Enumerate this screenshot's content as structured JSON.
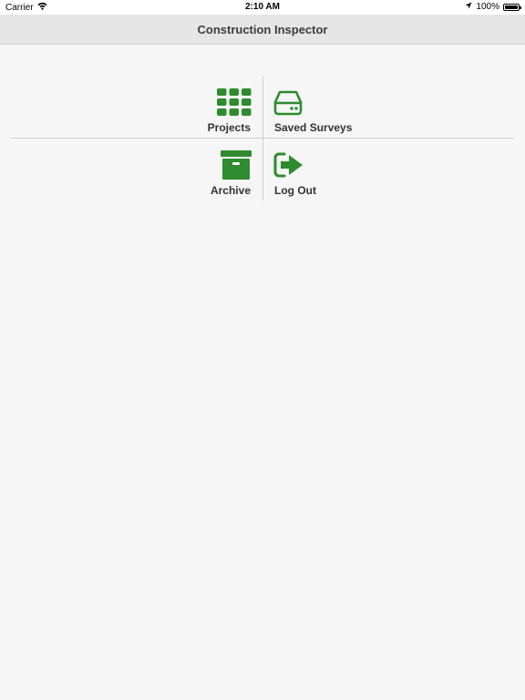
{
  "status_bar": {
    "carrier": "Carrier",
    "time": "2:10 AM",
    "battery": "100%",
    "icons": [
      "wifi-icon",
      "location-arrow-icon",
      "battery-icon"
    ]
  },
  "nav": {
    "title": "Construction Inspector"
  },
  "menu": {
    "items": [
      {
        "label": "Projects",
        "icon": "grid-icon"
      },
      {
        "label": "Saved Surveys",
        "icon": "hard-drive-icon"
      },
      {
        "label": "Archive",
        "icon": "archive-box-icon"
      },
      {
        "label": "Log Out",
        "icon": "sign-out-icon"
      }
    ]
  },
  "colors": {
    "accent": "#2e8b2e",
    "background": "#f6f6f6",
    "nav_background": "#e6e6e6",
    "text": "#333333"
  }
}
